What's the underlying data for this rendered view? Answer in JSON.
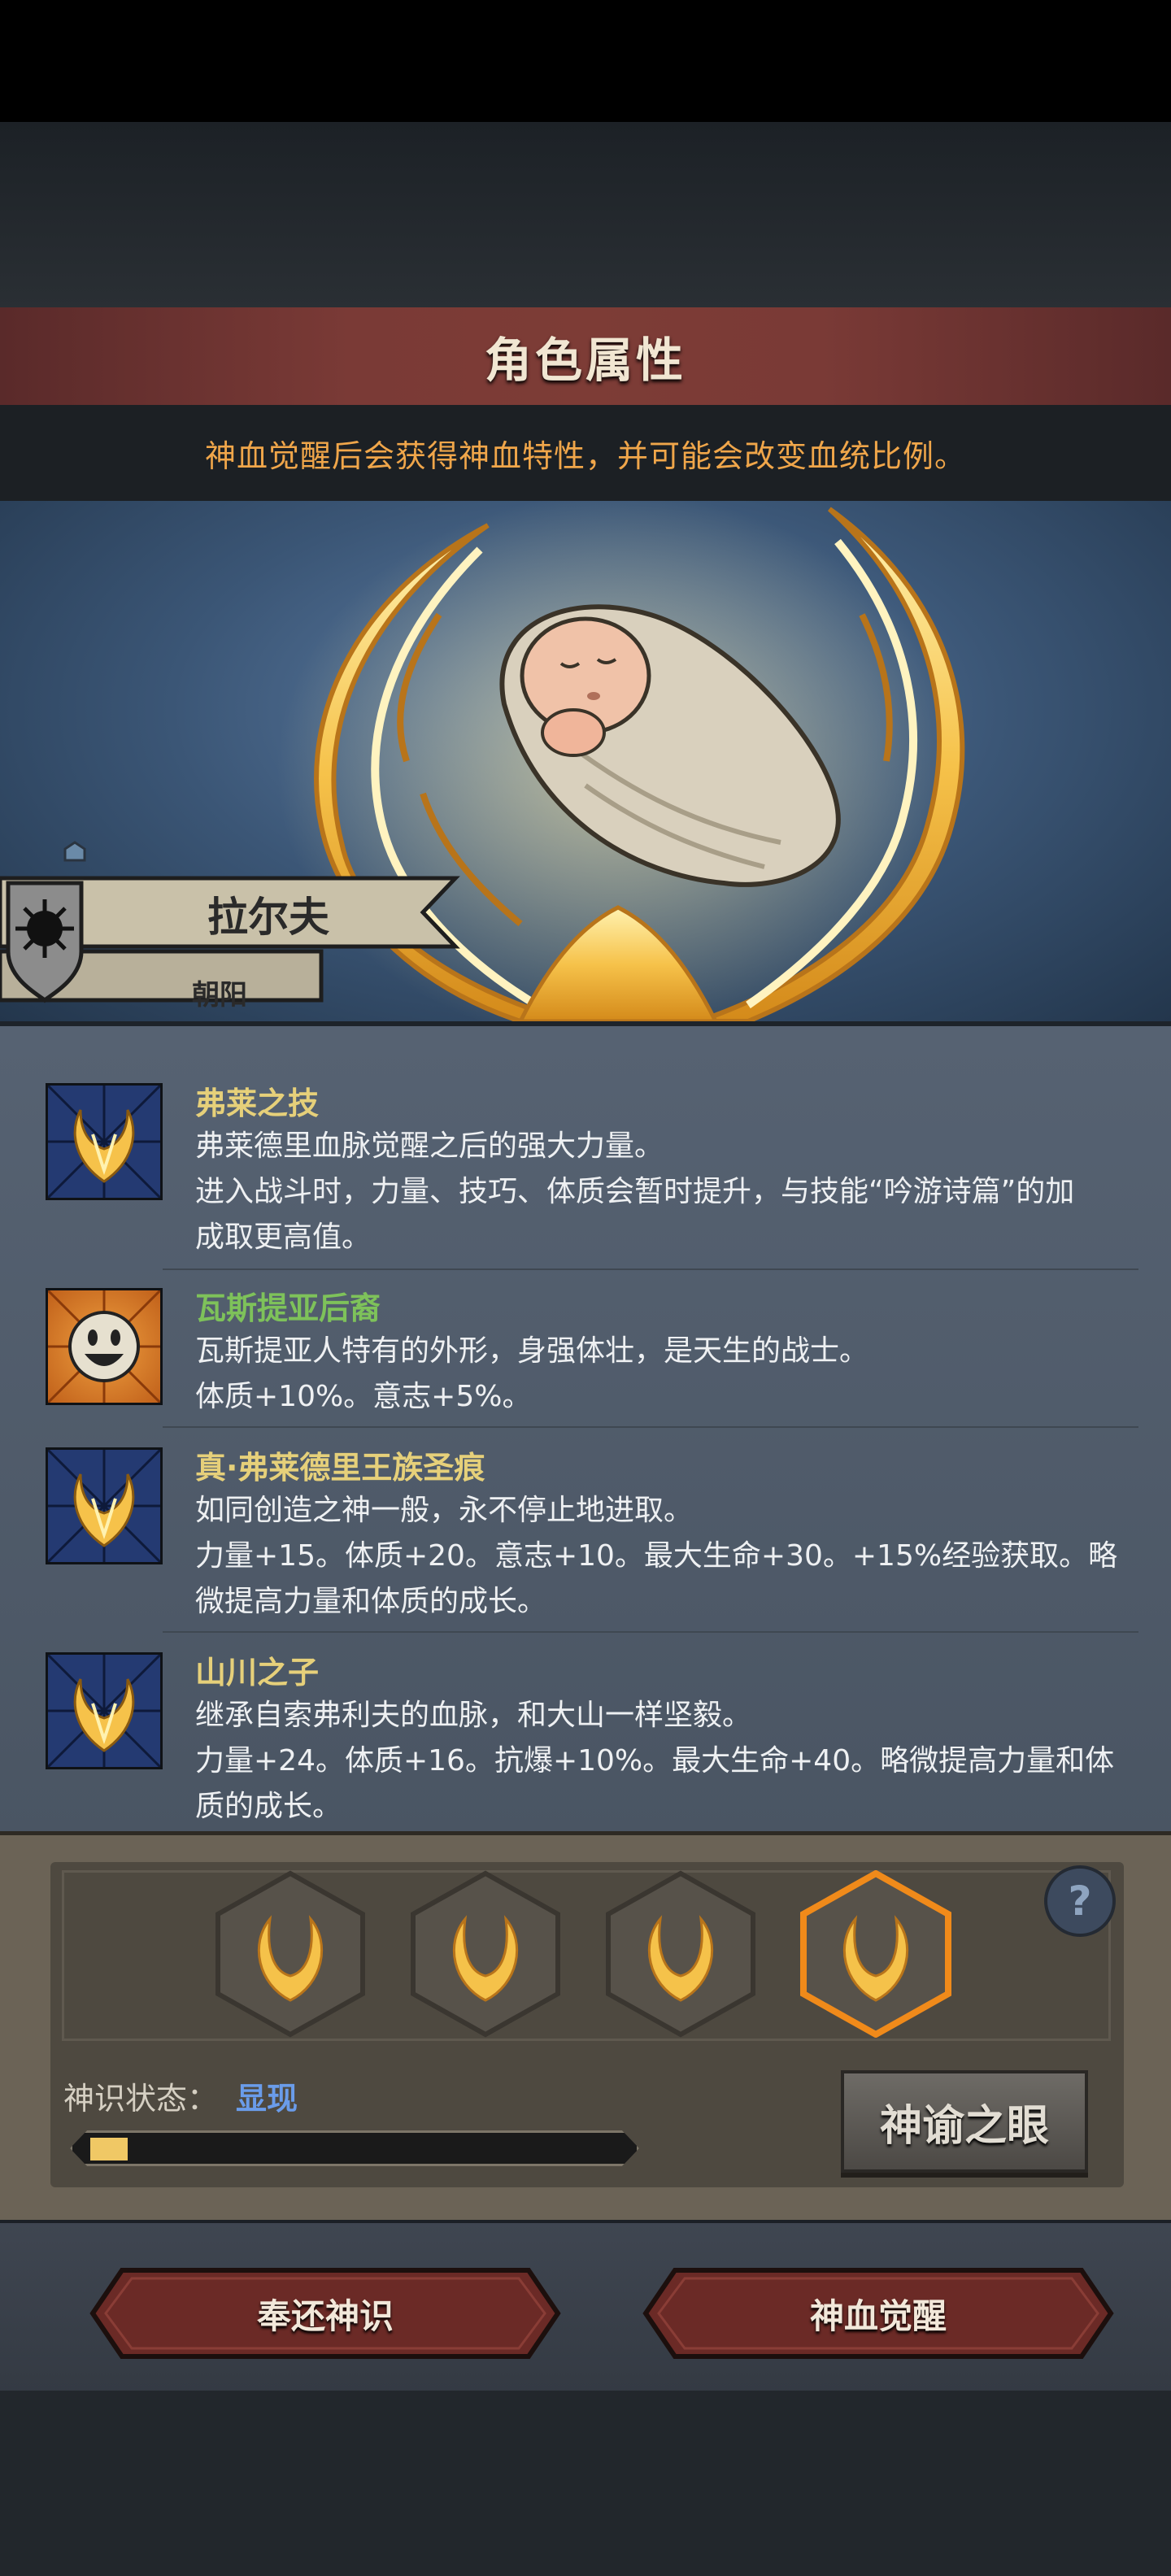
{
  "header": {
    "title": "角色属性",
    "subtitle": "神血觉醒后会获得神血特性，并可能会改变血统比例。"
  },
  "character": {
    "name": "拉尔夫",
    "epithet": "朝阳"
  },
  "traits": [
    {
      "name": "弗莱之技",
      "icon": "golden-flame-icon",
      "name_color": "#e6d07a",
      "lines": [
        "弗莱德里血脉觉醒之后的强大力量。",
        "进入战斗时，力量、技巧、体质会暂时提升，与技能“吟游诗篇”的加",
        "成取更高值。"
      ]
    },
    {
      "name": "瓦斯提亚后裔",
      "icon": "smiley-face-icon",
      "name_color": "#7ec25a",
      "lines": [
        "瓦斯提亚人特有的外形，身强体壮，是天生的战士。",
        "体质+10%。意志+5%。"
      ]
    },
    {
      "name": "真·弗莱德里王族圣痕",
      "icon": "golden-flame-icon",
      "name_color": "#e6d07a",
      "lines": [
        "如同创造之神一般，永不停止地进取。",
        "力量+15。体质+20。意志+10。最大生命+30。+15%经验获取。略",
        "微提高力量和体质的成长。"
      ]
    },
    {
      "name": "山川之子",
      "icon": "golden-flame-icon",
      "name_color": "#e6d07a",
      "lines": [
        "继承自索弗利夫的血脉，和大山一样坚毅。",
        "力量+24。体质+16。抗爆+10%。最大生命+40。略微提高力量和体",
        "质的成长。"
      ]
    }
  ],
  "divine_sense": {
    "label": "神识状态：",
    "value": "显现",
    "progress": 0.07,
    "eye_button": "神谕之眼",
    "help": "?"
  },
  "actions": {
    "return_button": "奉还神识",
    "awaken_button": "神血觉醒"
  },
  "colors": {
    "title_bar": "#7a3a36",
    "subtitle_text": "#f0a64a",
    "gold": "#f5c24a",
    "state_value": "#6a9cea"
  }
}
